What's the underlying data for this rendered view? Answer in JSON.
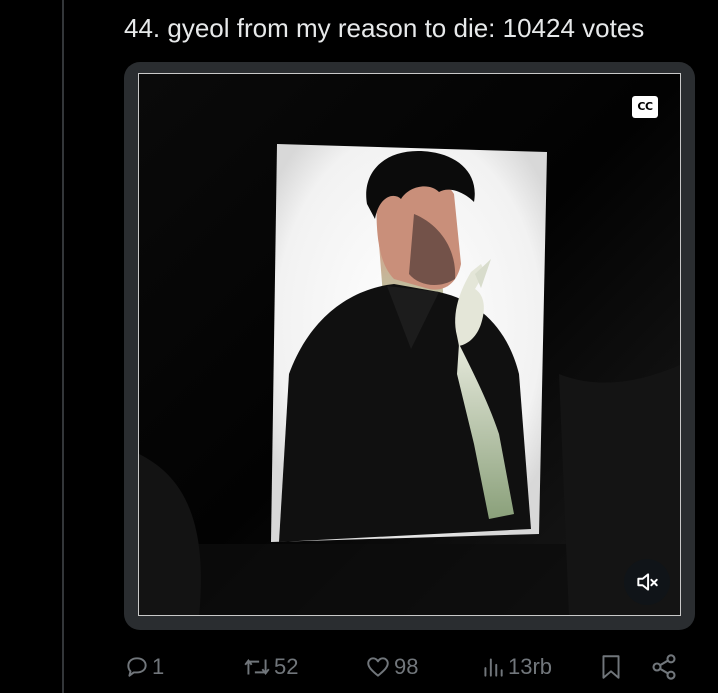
{
  "tweet": {
    "text": "44. gyeol from my reason to die: 10424 votes"
  },
  "video": {
    "cc_label": "CC",
    "muted": true
  },
  "actions": {
    "replies": "1",
    "reposts": "52",
    "likes": "98",
    "views": "13rb"
  },
  "icons": {
    "reply": "reply-icon",
    "repost": "repost-icon",
    "like": "heart-icon",
    "views": "views-icon",
    "bookmark": "bookmark-icon",
    "share": "share-icon",
    "mute": "volume-muted-icon"
  },
  "colors": {
    "background": "#000000",
    "text": "#e7e9ea",
    "muted_text": "#71767b",
    "divider": "#333639"
  }
}
